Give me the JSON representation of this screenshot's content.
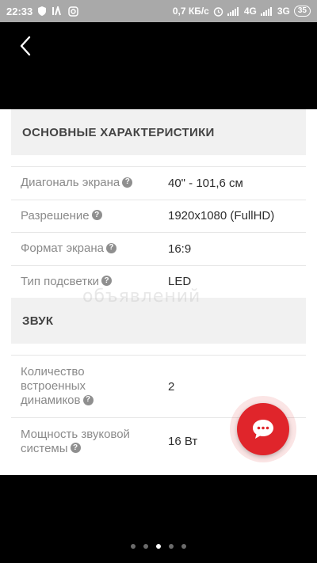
{
  "status_bar": {
    "time": "22:33",
    "speed": "0,7 КБ/с",
    "network_1": "4G",
    "network_2": "3G",
    "battery": "35",
    "icons": [
      "shield-icon",
      "vk-icon",
      "instagram-icon",
      "alarm-icon",
      "signal-icon",
      "signal-icon"
    ]
  },
  "header": {
    "back_icon": "chevron-left-icon"
  },
  "sections": [
    {
      "title": "ОСНОВНЫЕ ХАРАКТЕРИСТИКИ",
      "rows": [
        {
          "label": "Диагональ экрана",
          "value": "40\" - 101,6 см"
        },
        {
          "label": "Разрешение",
          "value": "1920x1080 (FullHD)"
        },
        {
          "label": "Формат экрана",
          "value": "16:9"
        },
        {
          "label": "Тип подсветки",
          "value": "LED"
        }
      ]
    },
    {
      "title": "ЗВУК",
      "rows": [
        {
          "label": "Количество встроенных динамиков",
          "value": "2"
        },
        {
          "label": "Мощность звуковой системы",
          "value": "16 Вт"
        }
      ]
    }
  ],
  "help_glyph": "?",
  "watermark": "объявлений",
  "chat_button": {
    "icon": "chat-bubble-icon",
    "color": "#e0252b"
  },
  "pager": {
    "count": 5,
    "active_index": 2
  }
}
